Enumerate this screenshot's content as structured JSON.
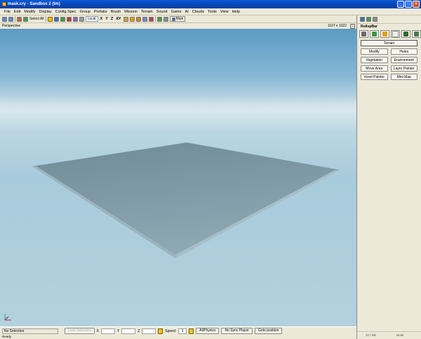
{
  "window": {
    "title": "mask.cry - Sandbox 2 (tm)",
    "controls": [
      "minimize",
      "maximize",
      "close"
    ]
  },
  "menu": [
    "File",
    "Edit",
    "Modify",
    "Display",
    "Config Spec",
    "Group",
    "Prefabs",
    "Brush",
    "Mission",
    "Terrain",
    "Sound",
    "Game",
    "AI",
    "Clouds",
    "Tools",
    "View",
    "Help"
  ],
  "toolbar": {
    "select_all": "Select All",
    "coord_system": "Local",
    "axes": [
      "X",
      "Y",
      "Z",
      "XY"
    ],
    "main_label": "Main"
  },
  "viewport": {
    "name": "Perspective",
    "resolution": "1197 x 1022"
  },
  "statusbar": {
    "selection": "No Selection",
    "lock_selection": "Lock Selection",
    "x_label": "X",
    "y_label": "Y",
    "z_label": "Z",
    "speed_label": "Speed:",
    "speed_value": "1",
    "ai_physics": "AI/Physics",
    "no_sync_player": "No Sync Player",
    "goto_position": "Goto position",
    "ready": "Ready"
  },
  "rollup": {
    "title": "RollupBar",
    "section": "Terrain",
    "tools": [
      "Modify",
      "Holes",
      "Vegetation",
      "Environment",
      "Move Area",
      "Layer Painter",
      "Voxel Painter",
      "Mini Map"
    ],
    "memory": "217 Mb",
    "mode": "NUM"
  },
  "colors": {
    "titlebar": "#0a5bd9",
    "sky_top": "#5b9bc4",
    "terrain_plane": "#7f9aa6"
  }
}
